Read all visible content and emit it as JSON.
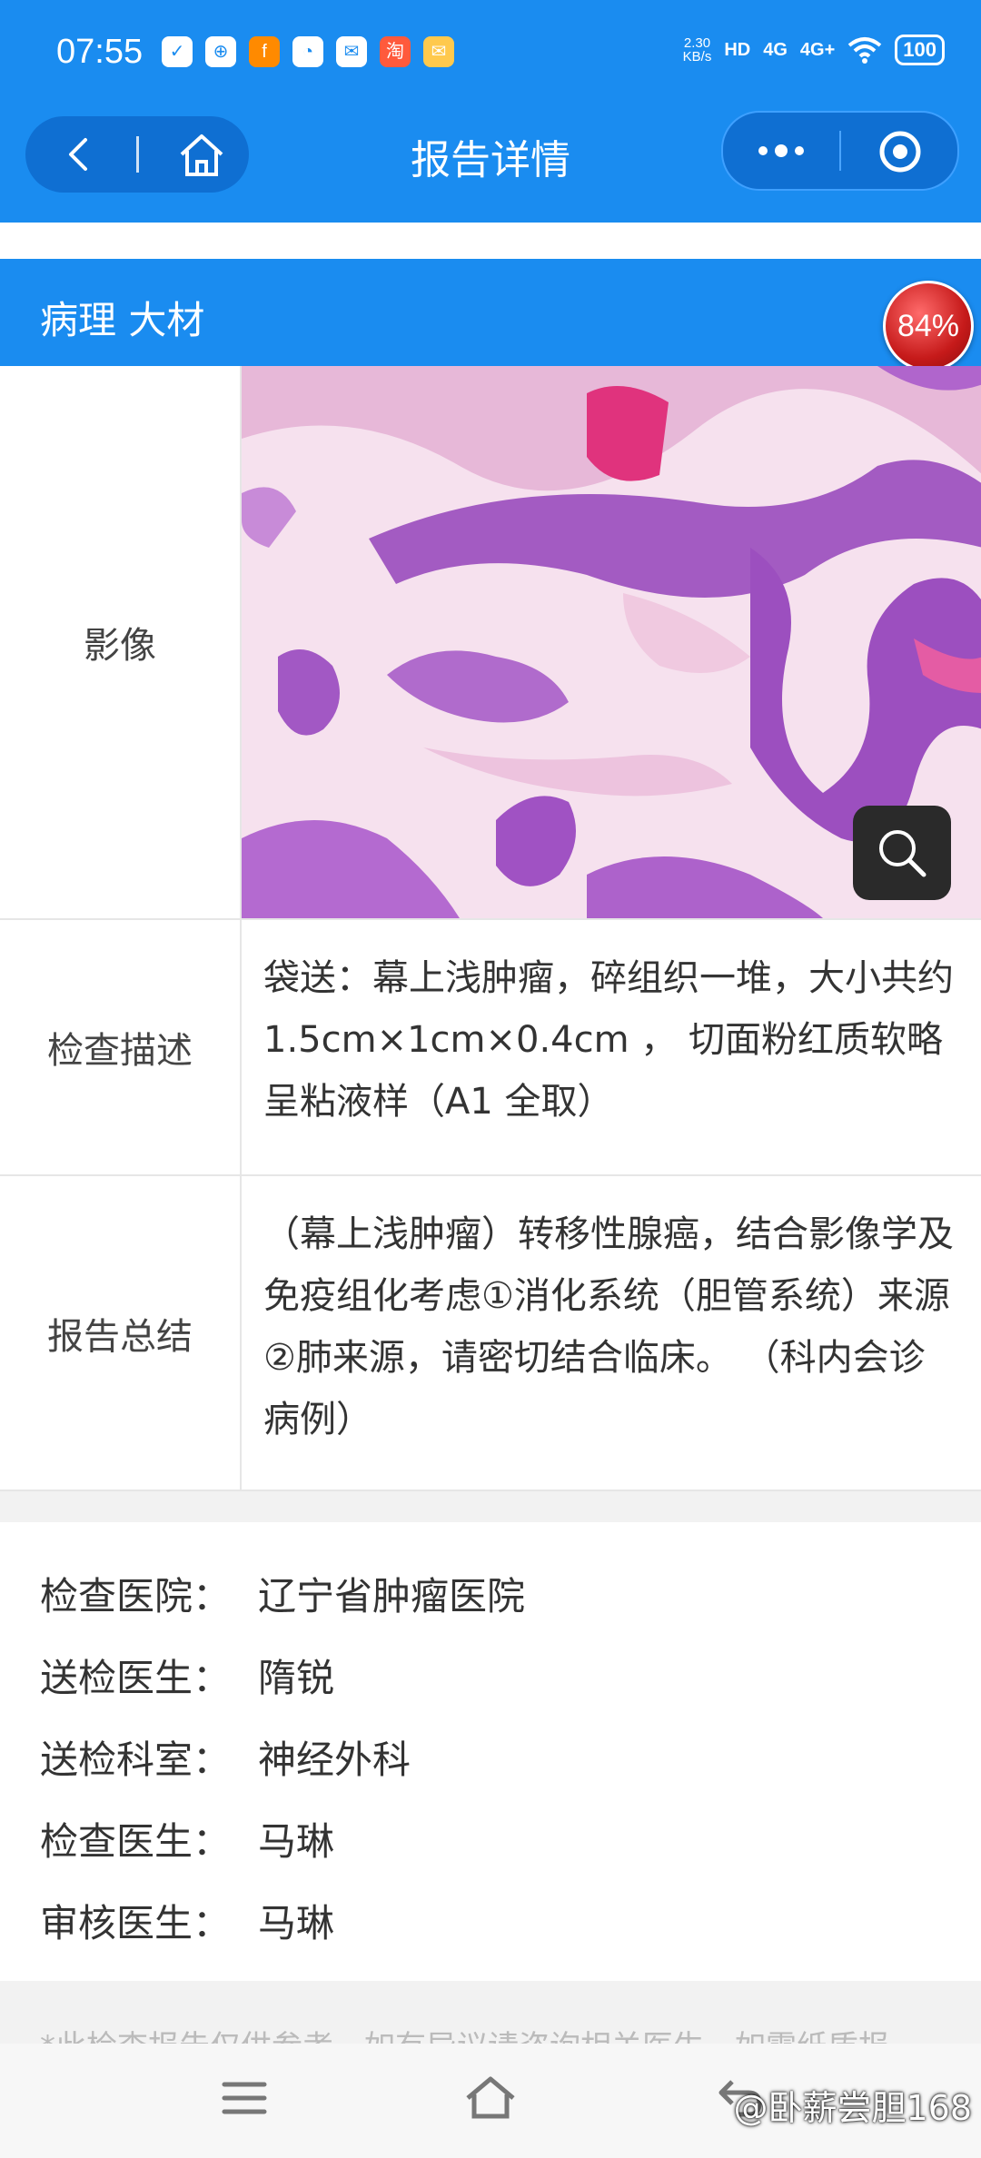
{
  "status": {
    "time": "07:55",
    "notifications": [
      "✓",
      "⊕",
      "f",
      "◔",
      "✉",
      "淘",
      "✉"
    ],
    "net_speed_value": "2.30",
    "net_speed_unit": "KB/s",
    "hd": "HD",
    "signal1": "4G",
    "signal2": "4G+",
    "battery": "100"
  },
  "nav": {
    "title": "报告详情"
  },
  "section": {
    "title": "病理 大材",
    "badge": "84%"
  },
  "table": {
    "image_label": "影像",
    "desc_label": "检查描述",
    "desc_value": "袋送：幕上浅肿瘤，碎组织一堆，大小共约 1.5cm×1cm×0.4cm ， 切面粉红质软略呈粘液样（A1 全取）",
    "summary_label": "报告总结",
    "summary_value": "（幕上浅肿瘤）转移性腺癌，结合影像学及免疫组化考虑①消化系统（胆管系统）来源②肺来源，请密切结合临床。 （科内会诊病例）"
  },
  "info": {
    "hospital_key": "检查医院：",
    "hospital_val": "辽宁省肿瘤医院",
    "send_doctor_key": "送检医生：",
    "send_doctor_val": "隋锐",
    "send_dept_key": "送检科室：",
    "send_dept_val": "神经外科",
    "exam_doctor_key": "检查医生：",
    "exam_doctor_val": "马琳",
    "review_doctor_key": "审核医生：",
    "review_doctor_val": "马琳"
  },
  "disclaimer": "*此检查报告仅供参考，如有异议请咨询相关医生，如需纸质报",
  "watermark": "@卧薪尝胆168"
}
